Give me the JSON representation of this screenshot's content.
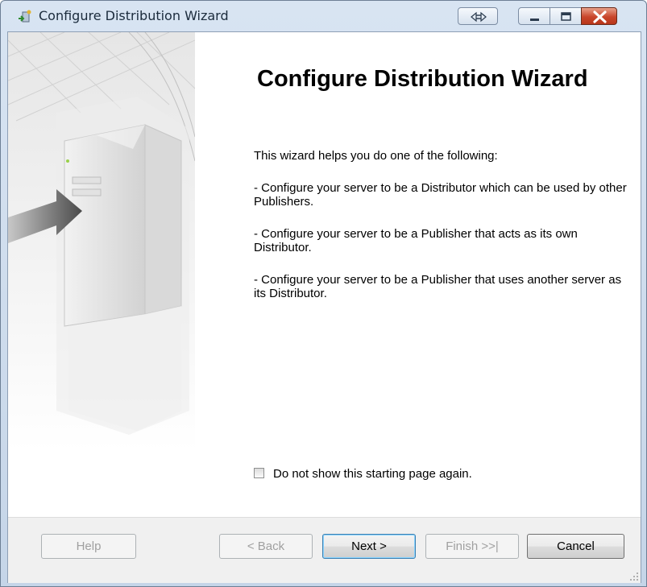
{
  "window": {
    "title": "Configure Distribution Wizard"
  },
  "page": {
    "heading": "Configure Distribution Wizard",
    "intro": "This wizard helps you do one of the following:",
    "options": [
      "- Configure your server to be a Distributor which can be used by other Publishers.",
      "- Configure your server to be a Publisher that acts as its own Distributor.",
      "- Configure your server to be a Publisher that uses another server as its Distributor."
    ],
    "checkbox_label": "Do not show this starting page again."
  },
  "footer": {
    "help": "Help",
    "back": "< Back",
    "next": "Next >",
    "finish": "Finish >>|",
    "cancel": "Cancel"
  }
}
